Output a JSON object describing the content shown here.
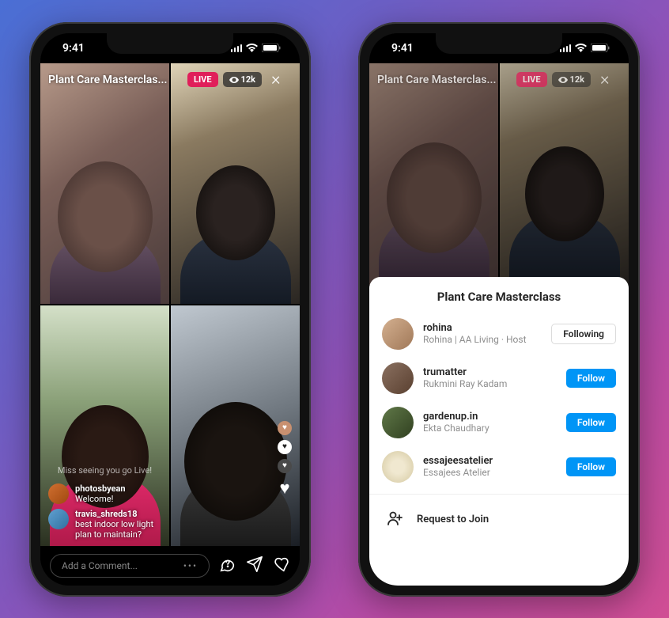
{
  "status": {
    "time": "9:41"
  },
  "live": {
    "title": "Plant Care Masterclas...",
    "live_label": "LIVE",
    "viewer_count": "12k"
  },
  "comments": {
    "faded_line": "Miss seeing you go Live!",
    "items": [
      {
        "user": "photosbyean",
        "text": "Welcome!"
      },
      {
        "user": "travis_shreds18",
        "text": "best indoor low light plan to maintain?"
      }
    ]
  },
  "composer": {
    "placeholder": "Add a Comment..."
  },
  "sheet": {
    "title": "Plant Care Masterclass",
    "participants": [
      {
        "username": "rohina",
        "name": "Rohina | AA Living · Host",
        "action": "Following",
        "style": "following"
      },
      {
        "username": "trumatter",
        "name": "Rukmini Ray Kadam",
        "action": "Follow",
        "style": "follow"
      },
      {
        "username": "gardenup.in",
        "name": "Ekta Chaudhary",
        "action": "Follow",
        "style": "follow"
      },
      {
        "username": "essajeesatelier",
        "name": "Essajees Atelier",
        "action": "Follow",
        "style": "follow"
      }
    ],
    "request_label": "Request to Join"
  }
}
